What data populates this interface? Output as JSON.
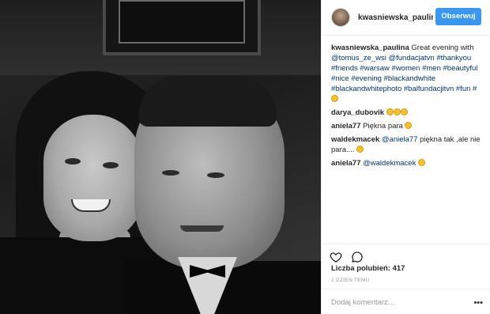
{
  "header": {
    "username": "kwasniewska_paulin",
    "follow_label": "Obserwuj"
  },
  "caption": {
    "username": "kwasniewska_paulina",
    "text": "Great evening with",
    "mention1": "@tomus_ze_wsi",
    "mention2": "@fundacjatvn",
    "hashtags_line1": "#thankyou",
    "hashtags_line2": "#friends #warsaw #women #men #beautyful",
    "hashtags_line3": "#nice #evening #blackandwhite",
    "hashtags_line4": "#blackandwhitephoto #balfundacjitvn #fun #"
  },
  "comments": [
    {
      "username": "darya_dubovik",
      "text": "",
      "emoji_count": 3
    },
    {
      "username": "aniela77",
      "text": "Piękna para",
      "emoji_count": 1
    },
    {
      "username": "waldekmacek",
      "mention": "@aniela77",
      "text": "piękna tak ,ale nie para....",
      "emoji_count": 1
    },
    {
      "username": "aniela77",
      "mention": "@waldekmacek",
      "text": "",
      "emoji_count": 1
    }
  ],
  "actions": {
    "like_icon": "heart-icon",
    "comment_icon": "comment-bubble-icon"
  },
  "likes": {
    "label": "Liczba polubień:",
    "count": "417"
  },
  "timestamp": "1 DZIEŃ TEMU",
  "add_comment": {
    "placeholder": "Dodaj komentarz...",
    "more_icon": "more-icon"
  },
  "colors": {
    "accent": "#3897f0",
    "link": "#003569",
    "muted": "#999999",
    "border": "#efefef"
  }
}
